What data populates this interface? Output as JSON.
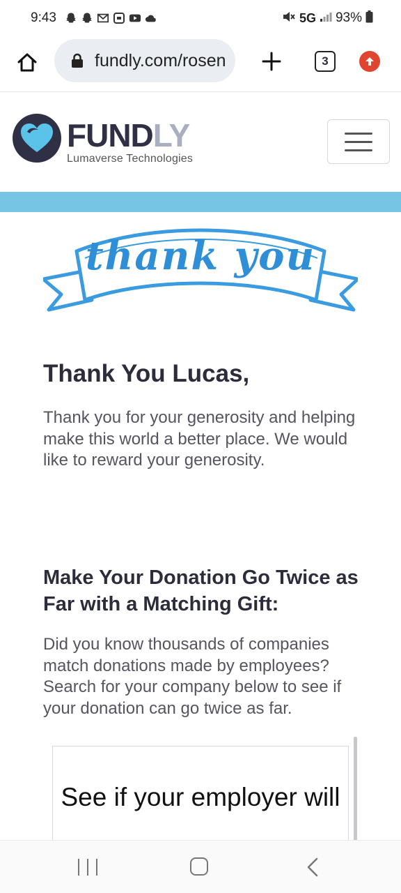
{
  "status_bar": {
    "time": "9:43",
    "network": "5G",
    "battery": "93%",
    "icons": [
      "snapchat-icon",
      "snapchat-icon",
      "gmail-icon",
      "app-icon",
      "youtube-icon",
      "cloud-icon"
    ]
  },
  "browser": {
    "url": "fundly.com/rosen",
    "tab_count": "3"
  },
  "site": {
    "brand_dark": "FUND",
    "brand_light": "LY",
    "tagline": "Lumaverse Technologies",
    "accent_color": "#76c5e4",
    "brand_color": "#2f2f45"
  },
  "banner": {
    "text": "thank you"
  },
  "content": {
    "greeting": "Thank You Lucas,",
    "thank_text": "Thank you for your generosity and helping make this world a better place. We would like to reward your generosity.",
    "matching_title": "Make Your Donation Go Twice as Far with a Matching Gift:",
    "matching_text": "Did you know thousands of companies match donations made by employees? Search for your company below to see if your donation can go twice as far.",
    "widget_text": "See if your employer will"
  }
}
